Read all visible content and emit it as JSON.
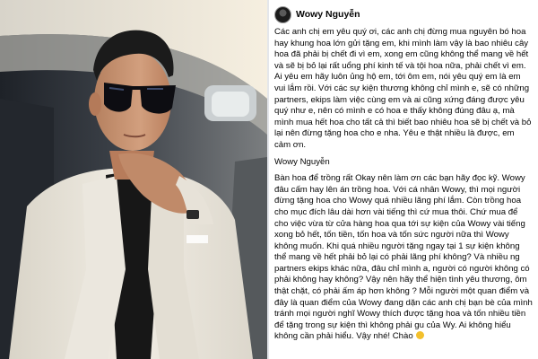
{
  "post": {
    "author": "Wowy Nguyễn",
    "paragraph_1": "Các anh chị em yêu quý ơi, các anh chị đừng mua nguyên bó hoa hay khung hoa lớn gửi tặng em, khi mình làm vậy là bao nhiêu cây hoa đã phải bị chết đi vì em, xong em cũng không thể mang về hết và sẽ bị bỏ lại rất uổng phí kinh tế và tội hoa nữa, phải chết vì em. Ai yêu em hãy luôn ủng hộ em, tới ôm em, nói yêu quý em là em vui lắm rồi. Với các sự kiện thương không chỉ mình e, sẽ có những partners, ekips làm việc cùng em và ai cũng xứng đáng được yêu quý như e, nên có mình e có hoa e thấy không đúng đâu ạ, mà mình mua hết hoa cho tất cả thì biết bao nhiêu hoa sẽ bị chết và bỏ lại nên đừng tặng hoa cho e nha. Yêu e thật nhiều là được, em cảm ơn.",
    "signature": "Wowy Nguyễn",
    "paragraph_2": "Bàn hoa để trồng rất Okay nên làm ơn các bạn hãy đọc kỹ. Wowy đâu cấm hay lên án trồng hoa. Với cá nhân Wowy, thì mọi người đừng tặng hoa cho Wowy quá nhiều lãng phí lắm. Còn trồng hoa cho mục đích lâu dài hơn vài tiếng thì cứ mua thôi. Chứ mua để cho việc vừa từ cửa hàng hoa qua tới sự kiện của Wowy vài tiếng xong bỏ hết, tốn tiền, tốn hoa và tốn sức người nữa thì Wowy không muốn. Khi quá nhiều người tặng ngay tại 1 sự kiện không thể mang về hết phải bỏ lại có phải lãng phí không? Và nhiều ng partners ekips khác nữa, đâu chỉ mình a, người có người không có phải không hay không? Vậy nên hãy thể hiện tình yêu thương, ôm thật chặt, có phải ấm áp hơn không ? Mỗi người một quan điểm và đây là quan điểm của Wowy đang dặn các anh chị bạn bè của mình tránh mọi người nghĩ Wowy thích được tặng hoa và tốn nhiều tiền để tặng trong sự kiện thì không phải gu của Wy. Ai không hiểu không cần phải hiểu. Vậy nhé! Chào"
  },
  "photo": {
    "shirt_color": "#e9e5dc",
    "shirt_dark": "#171717",
    "skin": "#c99573",
    "hair": "#1b1b1b",
    "glasses": "#0d0d12",
    "cabin_light": "#efe6d4",
    "cabin_mid": "#a4a5a1",
    "cabin_dark": "#3a3f46"
  },
  "colors": {
    "text": "#050505",
    "divider": "#e4e6eb",
    "emoji": "#f3c02c"
  },
  "icons": {
    "avatar": "profile-avatar",
    "emoji": "smile-emoji-icon"
  }
}
